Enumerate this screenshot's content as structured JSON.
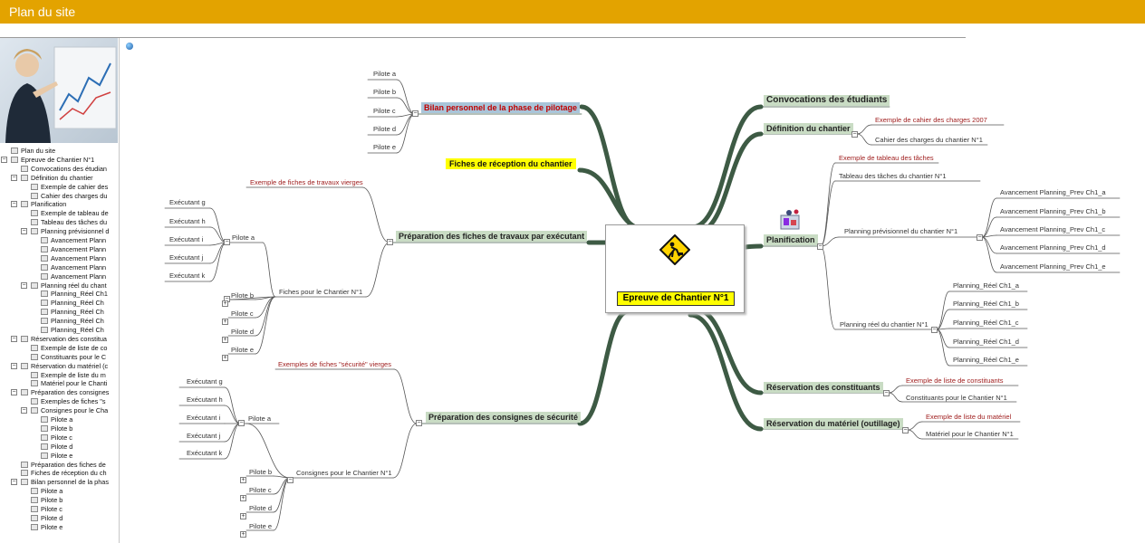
{
  "header": {
    "title": "Plan du site"
  },
  "tree": [
    {
      "label": "Plan du site",
      "level": 0
    },
    {
      "label": "Epreuve de Chantier N°1",
      "level": 0
    },
    {
      "label": "Convocations des étudian",
      "level": 1
    },
    {
      "label": "Définition du chantier",
      "level": 1
    },
    {
      "label": "Exemple de cahier des",
      "level": 2
    },
    {
      "label": "Cahier des charges du",
      "level": 2
    },
    {
      "label": "Planification",
      "level": 1
    },
    {
      "label": "Exemple de tableau de",
      "level": 2
    },
    {
      "label": "Tableau des tâches du",
      "level": 2
    },
    {
      "label": "Planning prévisionnel d",
      "level": 2
    },
    {
      "label": "Avancement Plann",
      "level": 3
    },
    {
      "label": "Avancement Plann",
      "level": 3
    },
    {
      "label": "Avancement Plann",
      "level": 3
    },
    {
      "label": "Avancement Plann",
      "level": 3
    },
    {
      "label": "Avancement Plann",
      "level": 3
    },
    {
      "label": "Planning réel du chant",
      "level": 2
    },
    {
      "label": "Planning_Réel Ch1",
      "level": 3
    },
    {
      "label": "Planning_Réel Ch",
      "level": 3
    },
    {
      "label": "Planning_Réel Ch",
      "level": 3
    },
    {
      "label": "Planning_Réel Ch",
      "level": 3
    },
    {
      "label": "Planning_Réel Ch",
      "level": 3
    },
    {
      "label": "Réservation des constitua",
      "level": 1
    },
    {
      "label": "Exemple de liste de co",
      "level": 2
    },
    {
      "label": "Constituants pour le C",
      "level": 2
    },
    {
      "label": "Réservation du matériel (c",
      "level": 1
    },
    {
      "label": "Exemple de liste du m",
      "level": 2
    },
    {
      "label": "Matériel pour le Chanti",
      "level": 2
    },
    {
      "label": "Préparation des consignes",
      "level": 1
    },
    {
      "label": "Exemples de fiches \"s",
      "level": 2
    },
    {
      "label": "Consignes pour le Cha",
      "level": 2
    },
    {
      "label": "Pilote a",
      "level": 3
    },
    {
      "label": "Pilote b",
      "level": 3
    },
    {
      "label": "Pilote c",
      "level": 3
    },
    {
      "label": "Pilote d",
      "level": 3
    },
    {
      "label": "Pilote e",
      "level": 3
    },
    {
      "label": "Préparation des fiches de",
      "level": 1
    },
    {
      "label": "Fiches de réception du ch",
      "level": 1
    },
    {
      "label": "Bilan personnel de la phas",
      "level": 1
    },
    {
      "label": "Pilote a",
      "level": 2
    },
    {
      "label": "Pilote b",
      "level": 2
    },
    {
      "label": "Pilote c",
      "level": 2
    },
    {
      "label": "Pilote d",
      "level": 2
    },
    {
      "label": "Pilote e",
      "level": 2
    }
  ],
  "map": {
    "center": "Epreuve de Chantier N°1",
    "bilan": {
      "label": "Bilan personnel de la phase de pilotage",
      "pilotes": [
        "Pilote a",
        "Pilote b",
        "Pilote c",
        "Pilote d",
        "Pilote e"
      ]
    },
    "fiches_reception": "Fiches de réception du chantier",
    "prep_fiches": {
      "label": "Préparation des fiches de travaux par exécutant",
      "example": "Exemple de fiches de travaux vierges",
      "sub": "Fiches pour le Chantier N°1",
      "pilote_a": "Pilote a",
      "executants": [
        "Exécutant g",
        "Exécutant h",
        "Exécutant i",
        "Exécutant j",
        "Exécutant k"
      ],
      "pilotes": [
        "Pilote b",
        "Pilote c",
        "Pilote d",
        "Pilote e"
      ]
    },
    "prep_consignes": {
      "label": "Préparation des consignes de sécurité",
      "example": "Exemples de fiches \"sécurité\" vierges",
      "sub": "Consignes pour le Chantier N°1",
      "pilote_a": "Pilote a",
      "executants": [
        "Exécutant g",
        "Exécutant h",
        "Exécutant i",
        "Exécutant j",
        "Exécutant k"
      ],
      "pilotes": [
        "Pilote b",
        "Pilote c",
        "Pilote d",
        "Pilote e"
      ]
    },
    "convocations": "Convocations des étudiants",
    "definition": {
      "label": "Définition du chantier",
      "example": "Exemple de cahier des charges 2007",
      "sub": "Cahier des charges du chantier N°1"
    },
    "planification": {
      "label": "Planification",
      "example": "Exemple de tableau des tâches",
      "tableau": "Tableau des tâches du chantier N°1",
      "prev": "Planning prévisionnel du chantier N°1",
      "prev_items": [
        "Avancement Planning_Prev Ch1_a",
        "Avancement Planning_Prev Ch1_b",
        "Avancement Planning_Prev Ch1_c",
        "Avancement Planning_Prev Ch1_d",
        "Avancement Planning_Prev Ch1_e"
      ],
      "reel": "Planning réel du chantier N°1",
      "reel_items": [
        "Planning_Réel Ch1_a",
        "Planning_Réel Ch1_b",
        "Planning_Réel Ch1_c",
        "Planning_Réel Ch1_d",
        "Planning_Réel Ch1_e"
      ]
    },
    "constituants": {
      "label": "Réservation des constituants",
      "example": "Exemple de liste de constituants",
      "sub": "Constituants pour le Chantier N°1"
    },
    "materiel": {
      "label": "Réservation du matériel (outillage)",
      "example": "Exemple de liste du matériel",
      "sub": "Matériel pour le Chantier N°1"
    }
  },
  "colors": {
    "header": "#e3a300",
    "branch": "#3d5a44",
    "yellow": "#ffff00",
    "main_bg": "#c9dcc4",
    "link": "#a02020"
  },
  "icons": [
    "globe-icon",
    "construction-worker-icon",
    "planification-icon",
    "expand-icon",
    "collapse-icon",
    "folder-icon"
  ]
}
